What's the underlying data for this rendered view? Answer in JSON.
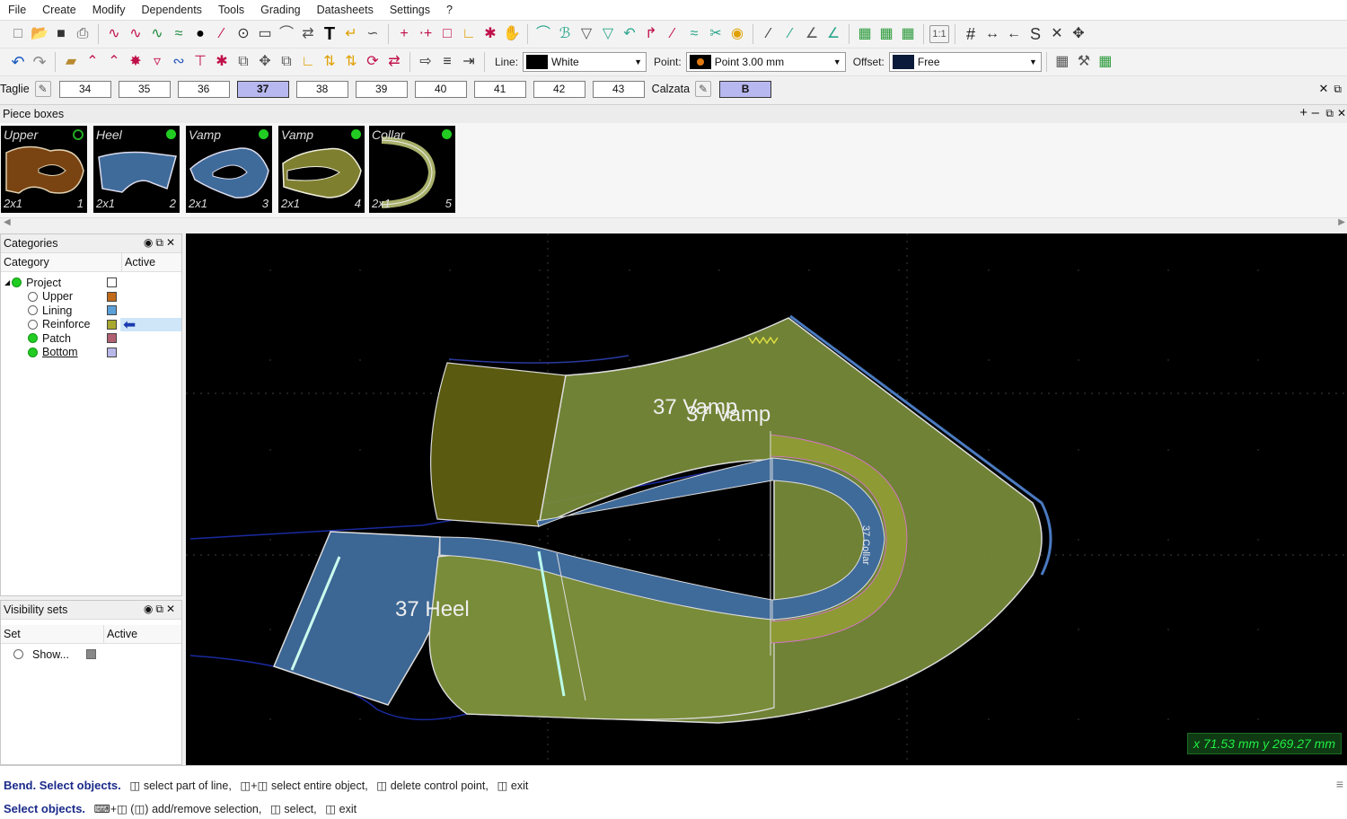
{
  "menu": [
    "File",
    "Create",
    "Modify",
    "Dependents",
    "Tools",
    "Grading",
    "Datasheets",
    "Settings",
    "?"
  ],
  "toolbar2": {
    "line_label": "Line:",
    "line_value": "White",
    "point_label": "Point:",
    "point_value": "Point 3.00 mm",
    "offset_label": "Offset:",
    "offset_value": "Free"
  },
  "sizebar": {
    "label": "Taglie",
    "sizes": [
      "34",
      "35",
      "36",
      "37",
      "38",
      "39",
      "40",
      "41",
      "42",
      "43"
    ],
    "active_size": "37",
    "calzata_label": "Calzata",
    "calzata_value": "B"
  },
  "piece_boxes": {
    "title": "Piece boxes",
    "pieces": [
      {
        "name": "Upper",
        "qty": "2x1",
        "num": "1",
        "color": "#7a4312"
      },
      {
        "name": "Heel",
        "qty": "2x1",
        "num": "2",
        "color": "#3f6b9b"
      },
      {
        "name": "Vamp",
        "qty": "2x1",
        "num": "3",
        "color": "#3f6b9b"
      },
      {
        "name": "Vamp",
        "qty": "2x1",
        "num": "4",
        "color": "#7f7f30"
      },
      {
        "name": "Collar",
        "qty": "2x1",
        "num": "5",
        "color": "#a9b06a"
      }
    ]
  },
  "categories": {
    "title": "Categories",
    "col_category": "Category",
    "col_active": "Active",
    "items": [
      {
        "label": "Project",
        "color": "#ffffff"
      },
      {
        "label": "Upper",
        "color": "#c06a1a"
      },
      {
        "label": "Lining",
        "color": "#5a9fd8"
      },
      {
        "label": "Reinforce",
        "color": "#a8a830"
      },
      {
        "label": "Patch",
        "color": "#b06070"
      },
      {
        "label": "Bottom",
        "color": "#b8b8e8"
      }
    ]
  },
  "visibility_sets": {
    "title": "Visibility sets",
    "col_set": "Set",
    "col_active": "Active",
    "item_label": "Show..."
  },
  "canvas": {
    "label_vamp_a": "37 Vamp",
    "label_vamp_b": "37 Vamp",
    "label_heel": "37 Heel",
    "label_collar": "37 Collar",
    "coords": "x 71.53 mm  y 269.27 mm"
  },
  "status": {
    "line1_bold": "Bend. Select objects.",
    "line1_a": "select part of line,",
    "line1_b": "select entire object,",
    "line1_c": "delete control point,",
    "line1_d": "exit",
    "line2_bold": "Select objects.",
    "line2_a": "add/remove selection,",
    "line2_b": "select,",
    "line2_c": "exit"
  }
}
